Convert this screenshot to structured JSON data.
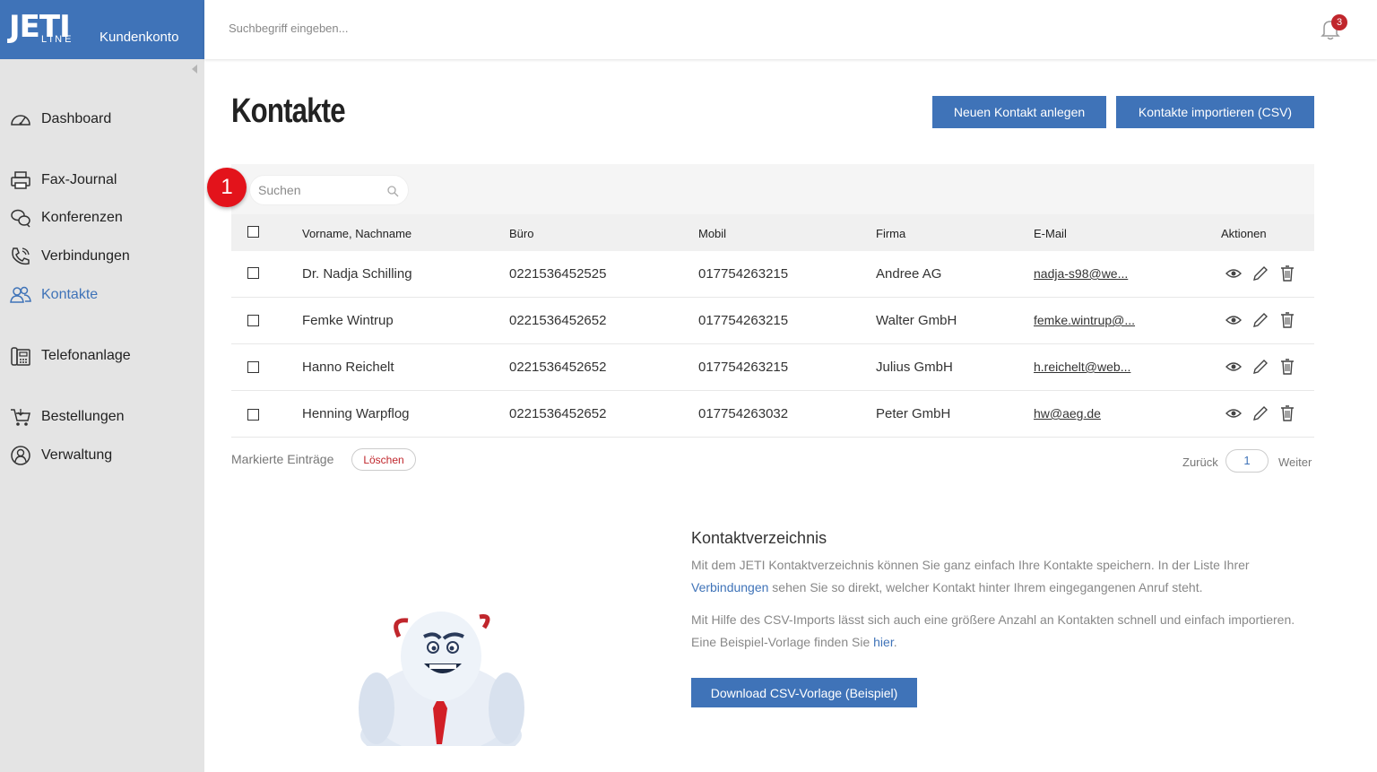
{
  "brand": {
    "logo_text": "JETI",
    "logo_sub": "LINE",
    "account_label": "Kundenkonto",
    "accent_color": "#3f73b8"
  },
  "topbar": {
    "search_placeholder": "Suchbegriff eingeben...",
    "notification_count": "3"
  },
  "sidebar": {
    "items": [
      {
        "label": "Dashboard",
        "icon": "speedometer-icon"
      },
      {
        "label": "Fax-Journal",
        "icon": "printer-icon"
      },
      {
        "label": "Konferenzen",
        "icon": "chat-bubbles-icon"
      },
      {
        "label": "Verbindungen",
        "icon": "phone-icon"
      },
      {
        "label": "Kontakte",
        "icon": "users-icon",
        "active": true
      },
      {
        "label": "Telefonanlage",
        "icon": "desk-phone-icon"
      },
      {
        "label": "Bestellungen",
        "icon": "cart-icon"
      },
      {
        "label": "Verwaltung",
        "icon": "user-circle-icon"
      }
    ]
  },
  "main": {
    "title": "Kontakte",
    "btn_new": "Neuen Kontakt anlegen",
    "btn_import": "Kontakte importieren (CSV)",
    "table_search_placeholder": "Suchen",
    "step_badge": "1",
    "columns": [
      "Vorname, Nachname",
      "Büro",
      "Mobil",
      "Firma",
      "E-Mail",
      "Aktionen"
    ],
    "rows": [
      {
        "name": "Dr. Nadja Schilling",
        "office": "0221536452525",
        "mobile": "017754263215",
        "company": "Andree AG",
        "email": "nadja-s98@we..."
      },
      {
        "name": "Femke Wintrup",
        "office": "0221536452652",
        "mobile": "017754263215",
        "company": "Walter GmbH",
        "email": "femke.wintrup@..."
      },
      {
        "name": "Hanno Reichelt",
        "office": "0221536452652",
        "mobile": "017754263215",
        "company": "Julius GmbH",
        "email": "h.reichelt@web..."
      },
      {
        "name": "Henning Warpflog",
        "office": "0221536452652",
        "mobile": "017754263032",
        "company": "Peter GmbH",
        "email": "hw@aeg.de"
      }
    ],
    "marked_label": "Markierte Einträge",
    "delete_label": "Löschen",
    "pager": {
      "prev": "Zurück",
      "page": "1",
      "next": "Weiter"
    }
  },
  "info": {
    "title": "Kontaktverzeichnis",
    "p1_a": "Mit dem JETI Kontaktverzeichnis können Sie ganz einfach Ihre Kontakte speichern. In der Liste Ihrer",
    "p1_link": "Verbindungen",
    "p1_b": " sehen Sie so direkt, welcher Kontakt hinter Ihrem eingegangenen Anruf steht.",
    "p2_a": "Mit Hilfe des CSV-Imports lässt sich auch eine größere Anzahl an Kontakten schnell und einfach importieren.",
    "p2_b": "Eine Beispiel-Vorlage finden Sie ",
    "p2_link": "hier",
    "p2_c": ".",
    "download_label": "Download CSV-Vorlage (Beispiel)"
  }
}
